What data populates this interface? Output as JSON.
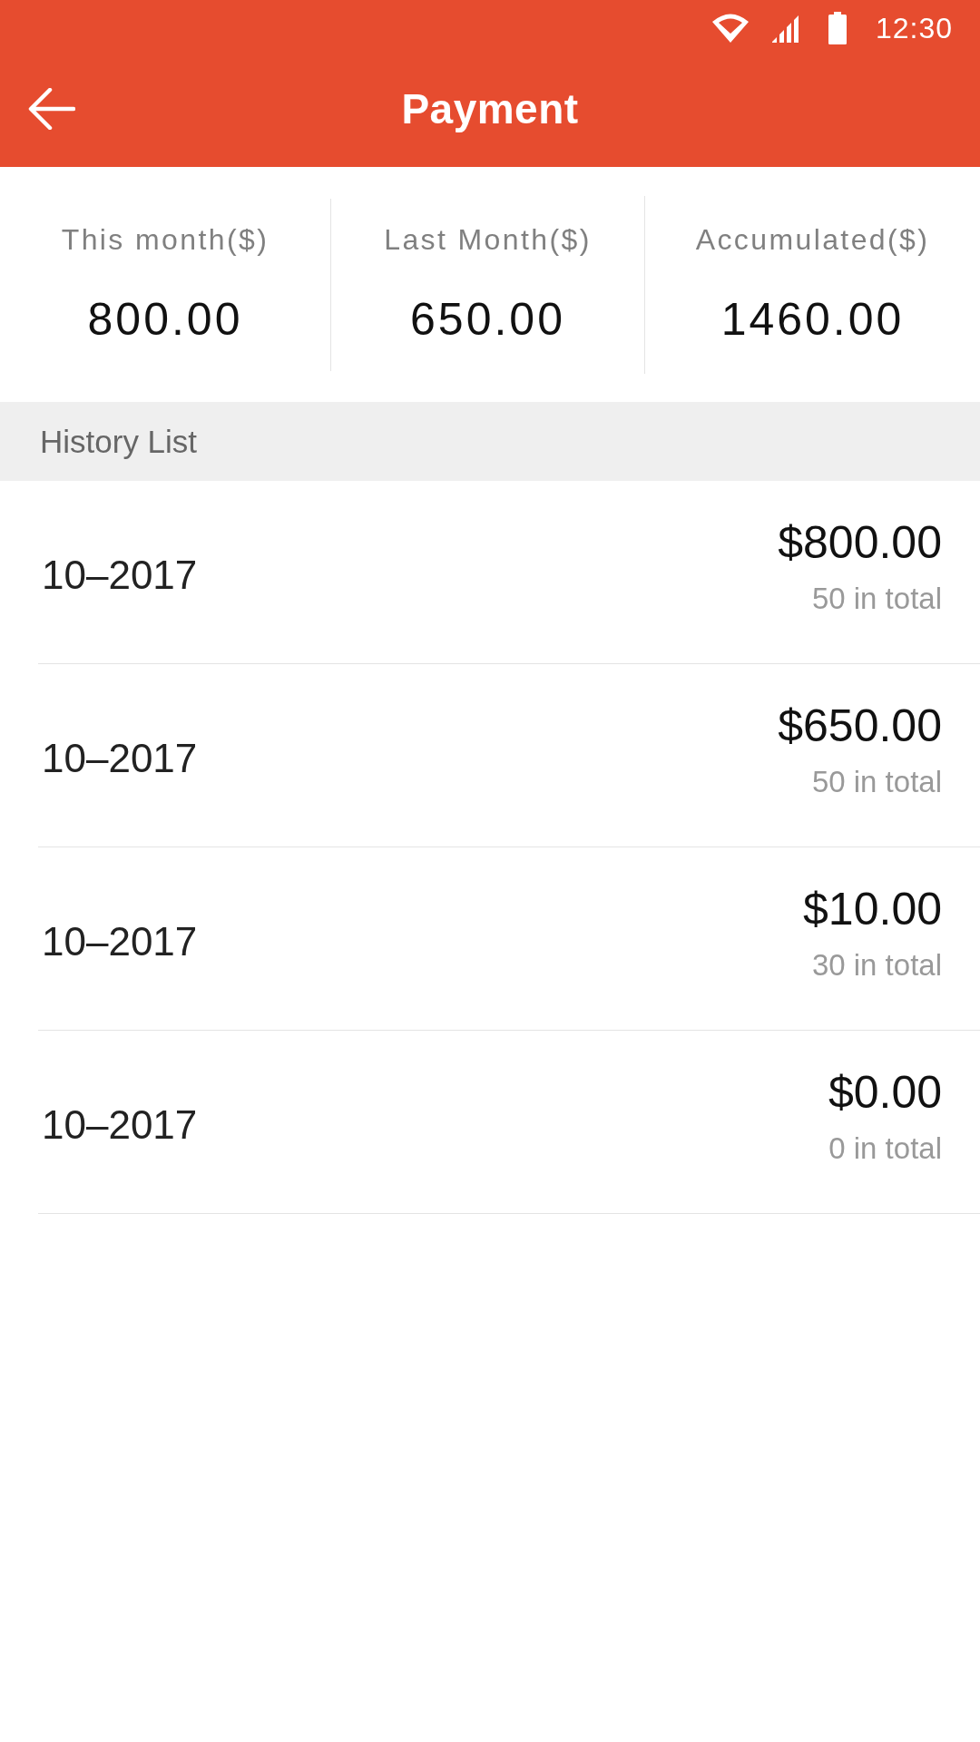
{
  "status_bar": {
    "time": "12:30"
  },
  "header": {
    "title": "Payment"
  },
  "summary": [
    {
      "label": "This month($)",
      "value": "800.00"
    },
    {
      "label": "Last Month($)",
      "value": "650.00"
    },
    {
      "label": "Accumulated($)",
      "value": "1460.00"
    }
  ],
  "history": {
    "title": "History List",
    "rows": [
      {
        "date": "10–2017",
        "amount": "$800.00",
        "count": "50 in total"
      },
      {
        "date": "10–2017",
        "amount": "$650.00",
        "count": "50 in total"
      },
      {
        "date": "10–2017",
        "amount": "$10.00",
        "count": "30 in total"
      },
      {
        "date": "10–2017",
        "amount": "$0.00",
        "count": "0 in total"
      }
    ]
  }
}
